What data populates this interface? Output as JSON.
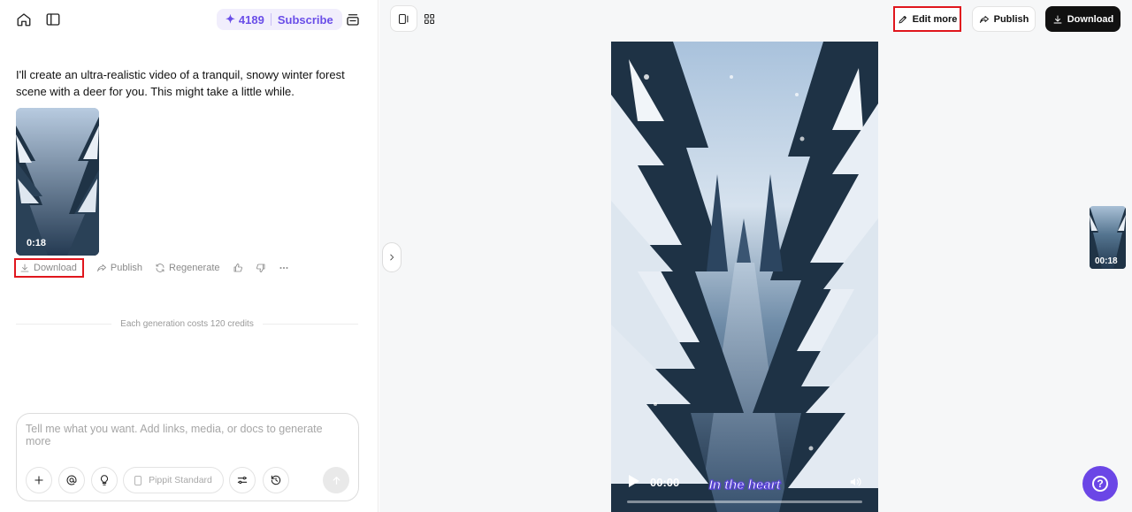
{
  "header": {
    "credits": "4189",
    "subscribe_label": "Subscribe"
  },
  "chat": {
    "message": "I'll create an ultra-realistic video of a tranquil, snowy winter forest scene with a deer for you. This might take a little while.",
    "thumbnail_duration": "0:18",
    "actions": {
      "download": "Download",
      "publish": "Publish",
      "regenerate": "Regenerate"
    },
    "cost_note": "Each generation costs 120 credits"
  },
  "composer": {
    "placeholder": "Tell me what you want. Add links, media, or docs to generate more",
    "model": "Pippit Standard"
  },
  "toolbar": {
    "edit_more": "Edit more",
    "publish": "Publish",
    "download": "Download"
  },
  "player": {
    "caption": "In the heart",
    "time": "00:00",
    "progress": 0
  },
  "side_thumb": {
    "duration": "00:18"
  },
  "help": {
    "symbol": "?"
  },
  "colors": {
    "accent": "#6b46e6",
    "highlight": "#e0161d"
  }
}
